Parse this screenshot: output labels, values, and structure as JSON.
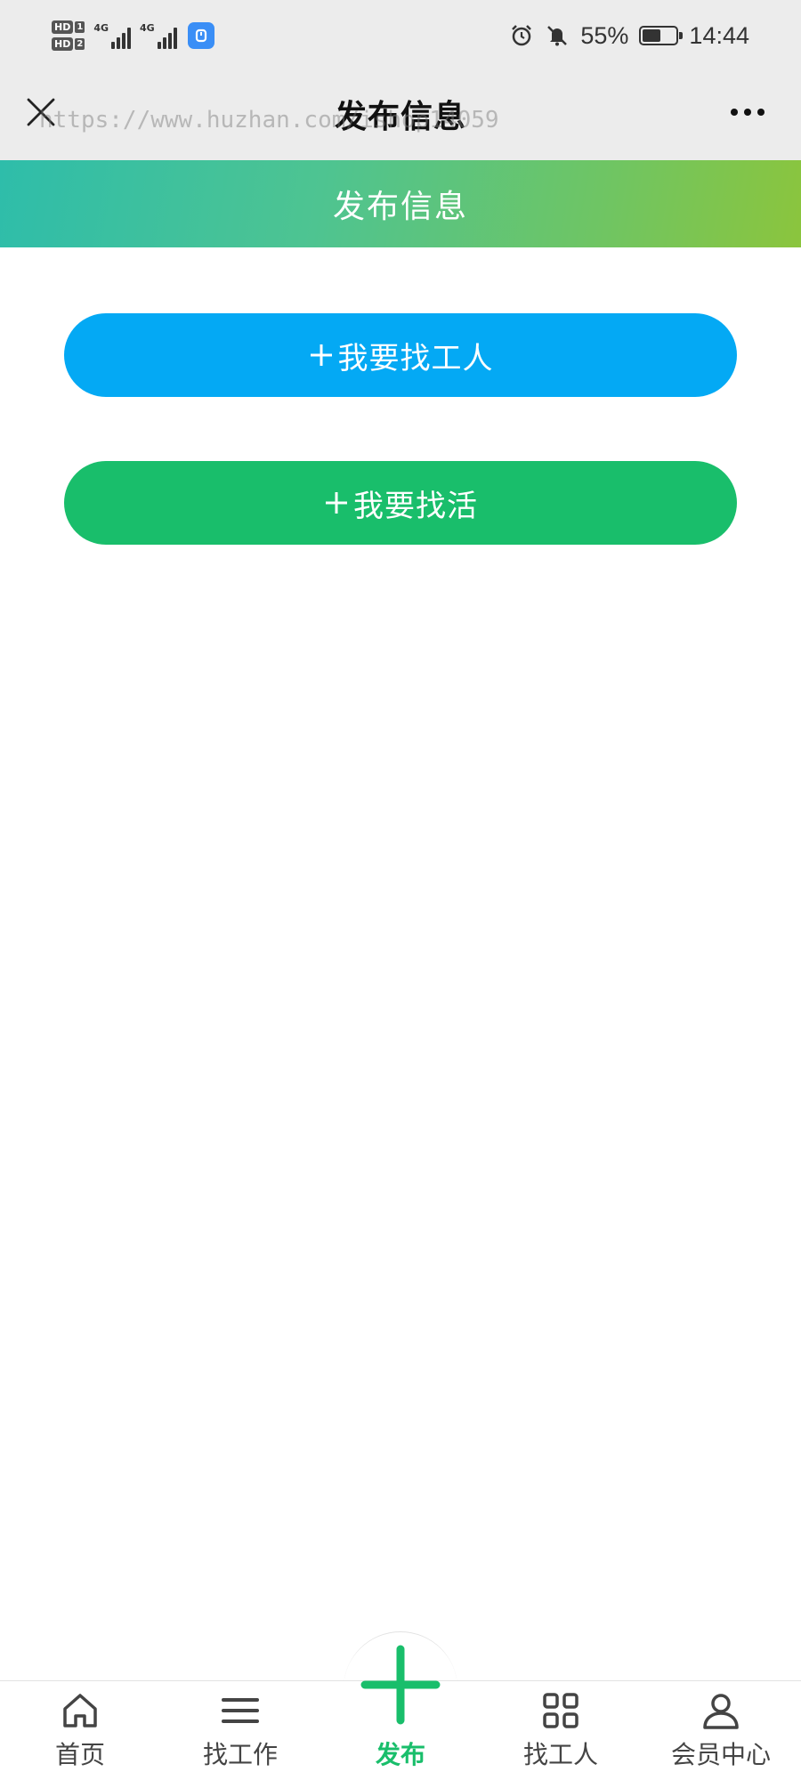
{
  "status_bar": {
    "sim1": "HD",
    "sim1_num": "1",
    "sim2": "HD",
    "sim2_num": "2",
    "network1": "4G",
    "network2": "4G",
    "battery_percent": "55%",
    "battery_level": 0.55,
    "time": "14:44",
    "icons": [
      "alarm-icon",
      "bell-muted-icon",
      "battery-icon"
    ]
  },
  "nav": {
    "title": "发布信息",
    "watermark": "https://www.huzhan.com/ishop14059"
  },
  "header": {
    "title": "发布信息"
  },
  "actions": {
    "hire_label": "我要找工人",
    "job_label": "我要找活",
    "hire_color": "#04a9f4",
    "job_color": "#19be6b"
  },
  "tabs": [
    {
      "label": "首页",
      "icon": "home-icon"
    },
    {
      "label": "找工作",
      "icon": "menu-icon"
    },
    {
      "label": "发布",
      "icon": "plus-icon",
      "active": true
    },
    {
      "label": "找工人",
      "icon": "grid-icon"
    },
    {
      "label": "会员中心",
      "icon": "user-icon"
    }
  ],
  "colors": {
    "accent_green": "#19be6b",
    "accent_blue": "#04a9f4",
    "header_gradient_start": "#2ebdaa",
    "header_gradient_end": "#8bc53d"
  }
}
